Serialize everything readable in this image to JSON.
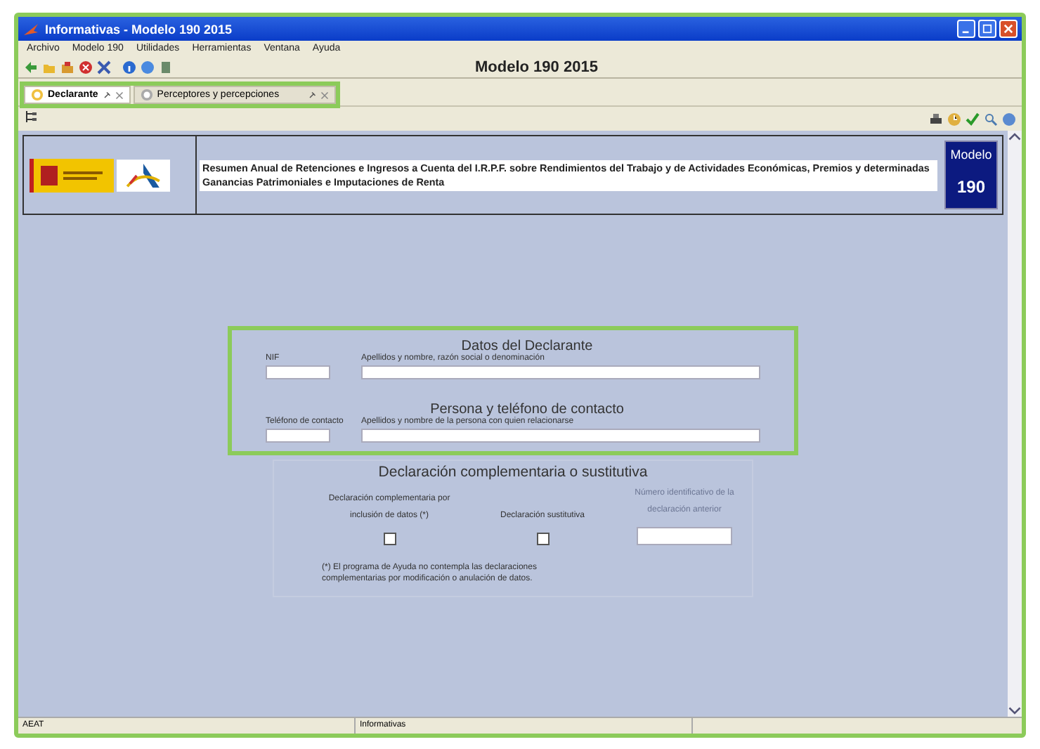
{
  "window": {
    "title": "Informativas - Modelo 190 2015"
  },
  "menu": [
    "Archivo",
    "Modelo 190",
    "Utilidades",
    "Herramientas",
    "Ventana",
    "Ayuda"
  ],
  "toolbar_title": "Modelo 190 2015",
  "tabs_highlighted": true,
  "tabs": [
    {
      "label": "Declarante",
      "selected": true
    },
    {
      "label": "Perceptores y percepciones",
      "selected": false
    }
  ],
  "header": {
    "description": "Resumen Anual de Retenciones e Ingresos a Cuenta del I.R.P.F. sobre Rendimientos del Trabajo y de Actividades Económicas, Premios y determinadas Ganancias Patrimoniales e Imputaciones de Renta",
    "model_label": "Modelo",
    "model_number": "190"
  },
  "declarant": {
    "highlighted": true,
    "title": "Datos del Declarante",
    "fields": [
      {
        "label": "NIF"
      },
      {
        "label": "Apellidos y nombre, razón social o denominación"
      }
    ],
    "contact_title": "Persona y teléfono de contacto",
    "contact_fields": [
      {
        "label": "Teléfono de contacto"
      },
      {
        "label": "Apellidos y nombre de la persona con quien relacionarse"
      }
    ]
  },
  "complementary": {
    "title": "Declaración complementaria o sustitutiva",
    "options": [
      {
        "label": "Declaración complementaria por inclusión de datos (*)",
        "checked": false
      },
      {
        "label": "Declaración sustitutiva",
        "checked": false
      }
    ],
    "previous": {
      "label": "Número identificativo de la declaración anterior",
      "disabled": true
    },
    "note": "(*) El programa de Ayuda no contempla las declaraciones complementarias por modificación o anulación de datos."
  },
  "status_bar": [
    "AEAT",
    "Informativas"
  ]
}
